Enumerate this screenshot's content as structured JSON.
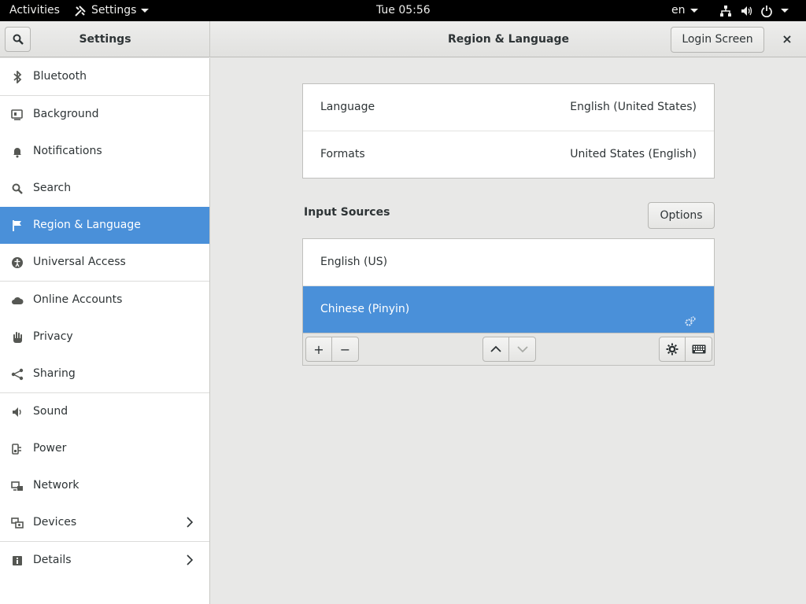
{
  "topbar": {
    "activities": "Activities",
    "app_name": "Settings",
    "clock": "Tue 05:56",
    "lang": "en"
  },
  "header": {
    "left_title": "Settings",
    "main_title": "Region & Language",
    "login_screen": "Login Screen",
    "close": "×"
  },
  "sidebar": {
    "items": [
      {
        "label": "Bluetooth",
        "icon": "bluetooth-icon"
      },
      {
        "label": "Background",
        "icon": "background-icon"
      },
      {
        "label": "Notifications",
        "icon": "bell-icon"
      },
      {
        "label": "Search",
        "icon": "search-icon"
      },
      {
        "label": "Region & Language",
        "icon": "flag-icon",
        "active": true
      },
      {
        "label": "Universal Access",
        "icon": "accessibility-icon"
      },
      {
        "label": "Online Accounts",
        "icon": "cloud-icon"
      },
      {
        "label": "Privacy",
        "icon": "hand-icon"
      },
      {
        "label": "Sharing",
        "icon": "share-icon"
      },
      {
        "label": "Sound",
        "icon": "speaker-icon"
      },
      {
        "label": "Power",
        "icon": "power-plug-icon"
      },
      {
        "label": "Network",
        "icon": "network-icon"
      },
      {
        "label": "Devices",
        "icon": "devices-icon",
        "chevron": true
      },
      {
        "label": "Details",
        "icon": "info-icon",
        "chevron": true
      }
    ]
  },
  "region": {
    "language_label": "Language",
    "language_value": "English (United States)",
    "formats_label": "Formats",
    "formats_value": "United States (English)"
  },
  "input_sources": {
    "title": "Input Sources",
    "options_label": "Options",
    "sources": [
      {
        "label": "English (US)",
        "selected": false
      },
      {
        "label": "Chinese (Pinyin)",
        "selected": true
      }
    ],
    "add": "+",
    "remove": "−"
  },
  "colors": {
    "accent": "#4a90d9",
    "topbar": "#000000",
    "background": "#e8e8e7"
  }
}
